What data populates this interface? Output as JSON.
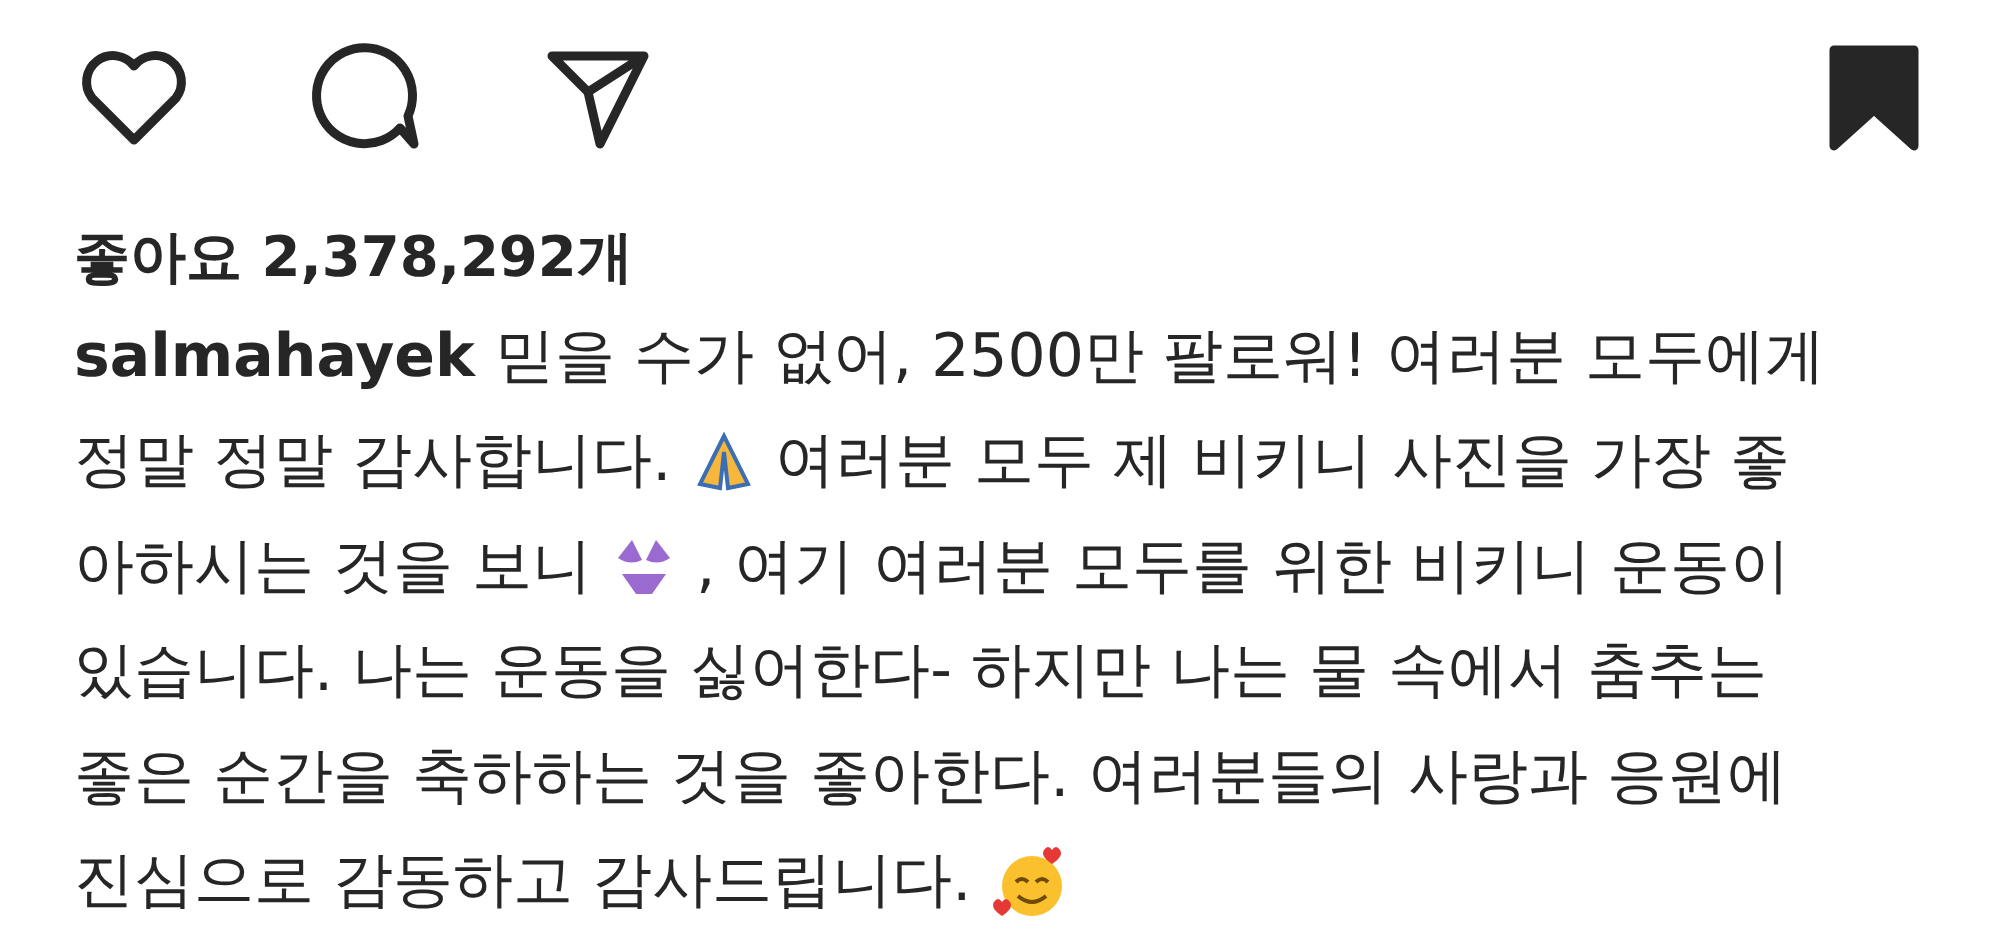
{
  "actions": {
    "liked": false,
    "saved": true
  },
  "likes": "좋아요 2,378,292개",
  "caption": {
    "username": "salmahayek",
    "lines": [
      [
        {
          "kind": "text",
          "text": "믿을 수가 없어, 2500만 팔로워! 여러분 모두에게"
        }
      ],
      [
        {
          "kind": "text",
          "text": "정말 정말 감사합니다."
        },
        {
          "kind": "pray"
        },
        {
          "kind": "text",
          "text": "여러분 모두 제 비키니 사진을 가장 좋"
        }
      ],
      [
        {
          "kind": "text",
          "text": "아하시는 것을 보니"
        },
        {
          "kind": "bikini"
        },
        {
          "kind": "text",
          "text": ", 여기 여러분 모두를 위한 비키니 운동이"
        }
      ],
      [
        {
          "kind": "text",
          "text": "있습니다. 나는 운동을 싫어한다- 하지만 나는 물 속에서 춤추는"
        }
      ],
      [
        {
          "kind": "text",
          "text": "좋은 순간을 축하하는 것을 좋아한다. 여러분들의 사랑과 응원에"
        }
      ],
      [
        {
          "kind": "text",
          "text": "진심으로 감동하고 감사드립니다."
        },
        {
          "kind": "hearts-face"
        }
      ]
    ]
  }
}
